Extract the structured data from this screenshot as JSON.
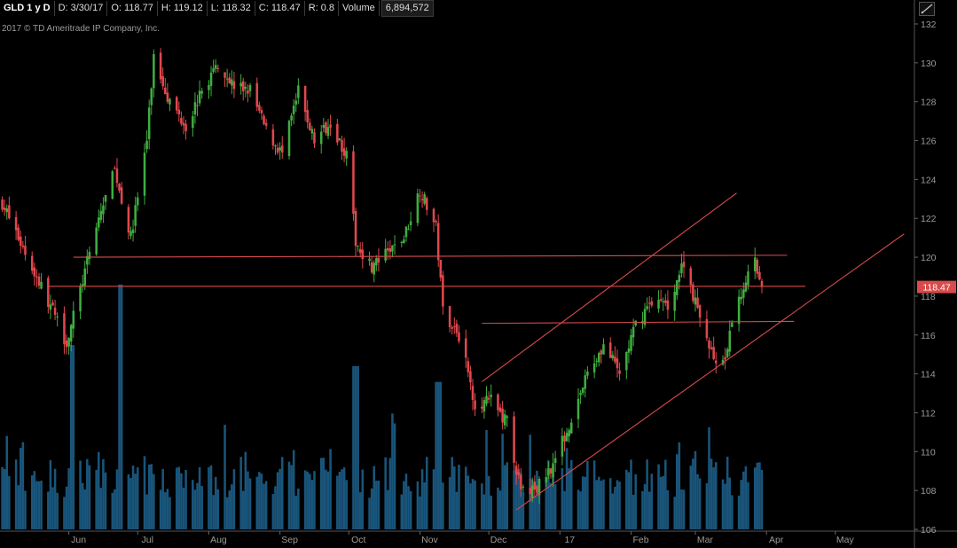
{
  "header": {
    "symbol": "GLD 1 y D",
    "date": "D: 3/30/17",
    "open": "O: 118.77",
    "high": "H: 119.12",
    "low": "L: 118.32",
    "close": "C: 118.47",
    "range": "R: 0.8",
    "volume_label": "Volume",
    "volume_value": "6,894,572"
  },
  "copyright": "2017 © TD Ameritrade IP Company, Inc.",
  "colors": {
    "up": "#3fae3f",
    "down": "#e0484d",
    "volume": "#1a5a82",
    "trendline": "#d94a4a",
    "price_tag": "#d94a4a",
    "axis_text": "#9a9a9a"
  },
  "icons": {
    "tool": "draw-line-icon"
  },
  "chart_data": {
    "type": "candlestick",
    "yaxis": {
      "ticks": [
        106,
        108,
        110,
        112,
        114,
        116,
        118,
        120,
        122,
        124,
        126,
        128,
        130,
        132
      ],
      "range": [
        106,
        132
      ],
      "position": "right"
    },
    "xaxis": {
      "labels": [
        "Jun",
        "Jul",
        "Aug",
        "Sep",
        "Oct",
        "Nov",
        "Dec",
        "17",
        "Feb",
        "Mar",
        "Apr",
        "May"
      ]
    },
    "last_price": "118.47",
    "anchors": [
      [
        "2016-05-03",
        122.8
      ],
      [
        "2016-05-10",
        121.0
      ],
      [
        "2016-05-17",
        119.2
      ],
      [
        "2016-05-24",
        117.5
      ],
      [
        "2016-05-31",
        115.6
      ],
      [
        "2016-06-07",
        118.8
      ],
      [
        "2016-06-14",
        122.0
      ],
      [
        "2016-06-21",
        124.5
      ],
      [
        "2016-06-28",
        121.0
      ],
      [
        "2016-07-05",
        126.0
      ],
      [
        "2016-07-08",
        130.3
      ],
      [
        "2016-07-15",
        128.0
      ],
      [
        "2016-07-22",
        126.8
      ],
      [
        "2016-07-29",
        128.5
      ],
      [
        "2016-08-05",
        130.0
      ],
      [
        "2016-08-12",
        128.8
      ],
      [
        "2016-08-19",
        128.6
      ],
      [
        "2016-08-26",
        126.5
      ],
      [
        "2016-09-02",
        125.3
      ],
      [
        "2016-09-09",
        128.5
      ],
      [
        "2016-09-16",
        126.0
      ],
      [
        "2016-09-23",
        127.0
      ],
      [
        "2016-09-30",
        125.2
      ],
      [
        "2016-10-04",
        120.8
      ],
      [
        "2016-10-11",
        119.5
      ],
      [
        "2016-10-18",
        120.2
      ],
      [
        "2016-10-25",
        121.0
      ],
      [
        "2016-11-01",
        123.5
      ],
      [
        "2016-11-08",
        121.5
      ],
      [
        "2016-11-11",
        117.3
      ],
      [
        "2016-11-18",
        116.0
      ],
      [
        "2016-11-25",
        112.5
      ],
      [
        "2016-12-02",
        112.6
      ],
      [
        "2016-12-09",
        111.5
      ],
      [
        "2016-12-15",
        107.9
      ],
      [
        "2016-12-22",
        108.1
      ],
      [
        "2016-12-30",
        109.6
      ],
      [
        "2017-01-06",
        111.7
      ],
      [
        "2017-01-13",
        114.0
      ],
      [
        "2017-01-20",
        115.5
      ],
      [
        "2017-01-27",
        114.0
      ],
      [
        "2017-02-03",
        116.5
      ],
      [
        "2017-02-10",
        117.8
      ],
      [
        "2017-02-17",
        117.5
      ],
      [
        "2017-02-24",
        119.8
      ],
      [
        "2017-03-03",
        116.8
      ],
      [
        "2017-03-10",
        114.6
      ],
      [
        "2017-03-14",
        114.4
      ],
      [
        "2017-03-17",
        116.8
      ],
      [
        "2017-03-24",
        119.2
      ],
      [
        "2017-03-27",
        119.8
      ],
      [
        "2017-03-30",
        118.47
      ]
    ],
    "volume_spikes": [
      [
        "2016-06-24",
        0.93
      ],
      [
        "2016-11-09",
        0.56
      ],
      [
        "2016-10-04",
        0.62
      ],
      [
        "2016-06-03",
        0.7
      ]
    ],
    "trendlines": [
      {
        "from": [
          "2016-06-03",
          120.0
        ],
        "to": [
          "2017-04-10",
          120.1
        ]
      },
      {
        "from": [
          "2016-05-23",
          118.5
        ],
        "to": [
          "2017-04-18",
          118.5
        ]
      },
      {
        "from": [
          "2016-11-28",
          116.6
        ],
        "to": [
          "2017-04-13",
          116.7
        ]
      },
      {
        "from": [
          "2016-11-28",
          113.6
        ],
        "to": [
          "2017-03-19",
          123.3
        ]
      },
      {
        "from": [
          "2016-12-13",
          107.0
        ],
        "to": [
          "2017-05-31",
          121.2
        ]
      }
    ]
  }
}
